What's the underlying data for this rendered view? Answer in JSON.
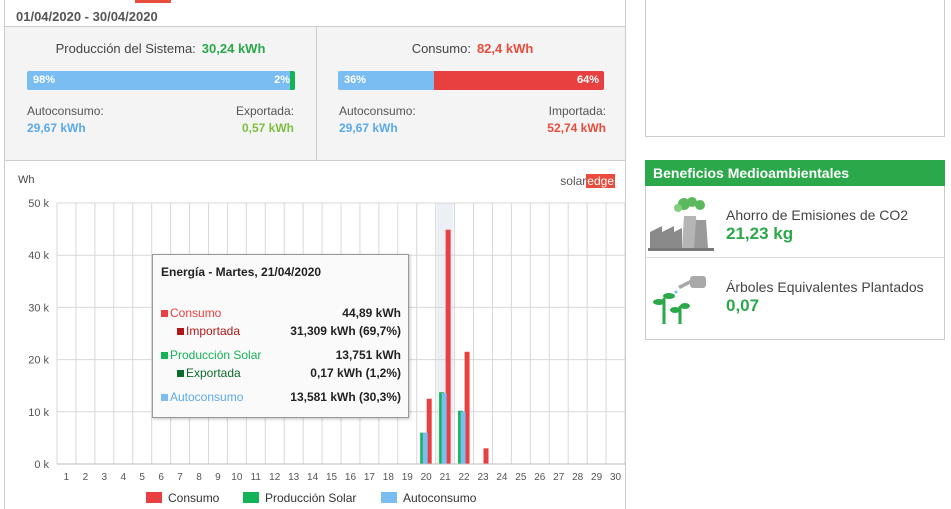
{
  "date_range": "01/04/2020 - 30/04/2020",
  "production": {
    "title": "Producción del Sistema:",
    "total": "30,24 kWh",
    "self_pct_label": "98%",
    "export_pct_label": "2%",
    "self_fraction": 0.98,
    "self_label": "Autoconsumo:",
    "self_value": "29,67 kWh",
    "export_label": "Exportada:",
    "export_value": "0,57 kWh"
  },
  "consumption": {
    "title": "Consumo:",
    "total": "82,4 kWh",
    "self_pct_label": "36%",
    "import_pct_label": "64%",
    "self_fraction": 0.36,
    "self_label": "Autoconsumo:",
    "self_value": "29,67 kWh",
    "import_label": "Importada:",
    "import_value": "52,74 kWh"
  },
  "colors": {
    "consumo": "#e84040",
    "produccion": "#13b357",
    "autoconsumo": "#79bdf3",
    "green_text": "#2aa84a",
    "red_text": "#e74c3c",
    "blue_text": "#5aa9ea",
    "light_green_text": "#7fbf40"
  },
  "logo": {
    "solar": "solar",
    "edge": "edge"
  },
  "tooltip": {
    "title": "Energía - Martes, 21/04/2020",
    "rows": [
      {
        "label": "Consumo",
        "value": "44,89 kWh"
      },
      {
        "label": "Importada",
        "value": "31,309 kWh (69,7%)"
      },
      {
        "label": "Producción Solar",
        "value": "13,751 kWh"
      },
      {
        "label": "Exportada",
        "value": "0,17 kWh (1,2%)"
      },
      {
        "label": "Autoconsumo",
        "value": "13,581 kWh (30,3%)"
      }
    ]
  },
  "chart_data": {
    "type": "bar",
    "ylabel": "Wh",
    "ylim": [
      0,
      50000
    ],
    "ytick_labels": [
      "0 k",
      "10 k",
      "20 k",
      "30 k",
      "40 k",
      "50 k"
    ],
    "yticks": [
      0,
      10000,
      20000,
      30000,
      40000,
      50000
    ],
    "categories": [
      "1",
      "2",
      "3",
      "4",
      "5",
      "6",
      "7",
      "8",
      "9",
      "10",
      "11",
      "12",
      "13",
      "14",
      "15",
      "16",
      "17",
      "18",
      "19",
      "20",
      "21",
      "22",
      "23",
      "24",
      "25",
      "26",
      "27",
      "28",
      "29",
      "30"
    ],
    "series": [
      {
        "name": "Consumo",
        "values": [
          0,
          0,
          0,
          0,
          0,
          0,
          0,
          0,
          0,
          0,
          0,
          0,
          0,
          0,
          0,
          0,
          0,
          0,
          0,
          12500,
          44890,
          21500,
          3000,
          0,
          0,
          0,
          0,
          0,
          0,
          0
        ]
      },
      {
        "name": "Producción Solar",
        "values": [
          0,
          0,
          0,
          0,
          0,
          0,
          0,
          0,
          0,
          0,
          0,
          0,
          0,
          0,
          0,
          0,
          0,
          0,
          0,
          6000,
          13751,
          10200,
          0,
          0,
          0,
          0,
          0,
          0,
          0,
          0
        ]
      },
      {
        "name": "Autoconsumo",
        "values": [
          0,
          0,
          0,
          0,
          0,
          0,
          0,
          0,
          0,
          0,
          0,
          0,
          0,
          0,
          0,
          0,
          0,
          0,
          0,
          6000,
          13581,
          10000,
          0,
          0,
          0,
          0,
          0,
          0,
          0,
          0
        ]
      }
    ],
    "highlighted_category": "21",
    "grid": true,
    "legend_position": "bottom"
  },
  "benefits": {
    "header": "Beneficios Medioambientales",
    "co2_label": "Ahorro de Emisiones de CO2",
    "co2_value": "21,23 kg",
    "trees_label": "Árboles Equivalentes Plantados",
    "trees_value": "0,07"
  }
}
